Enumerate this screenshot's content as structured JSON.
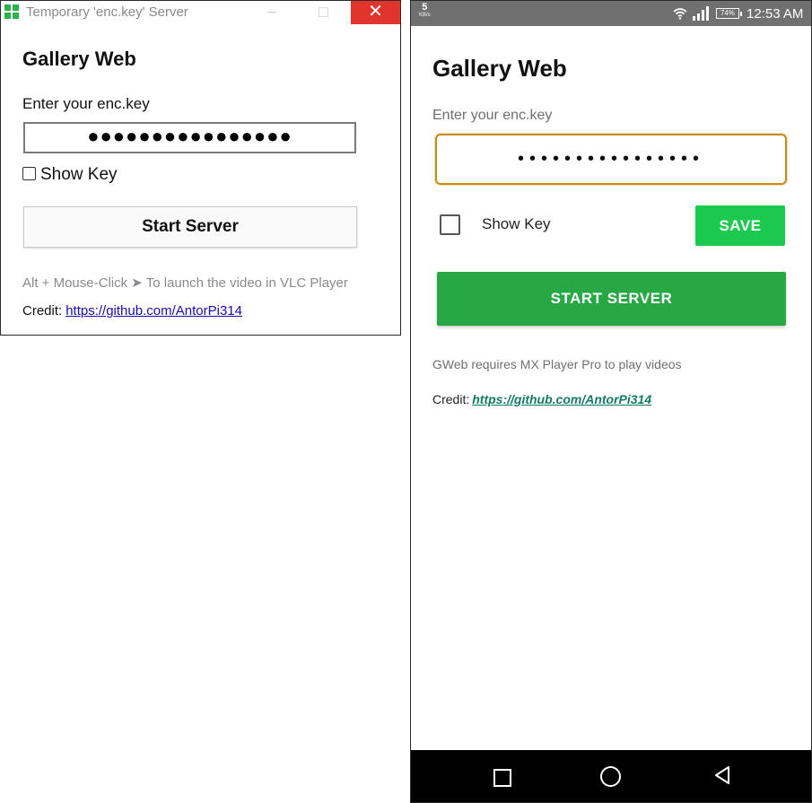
{
  "desktop": {
    "window_title": "Temporary 'enc.key' Server",
    "close_glyph": "✕",
    "heading": "Gallery Web",
    "input_label": "Enter your enc.key",
    "input_value": "●●●●●●●●●●●●●●●●",
    "show_key_label": "Show Key",
    "start_button": "Start Server",
    "hint": "Alt + Mouse-Click ➤ To launch the video in VLC Player",
    "credit_label": "Credit:",
    "credit_link": "https://github.com/AntorPi314",
    "colors": {
      "close_button": "#e0342c",
      "link": "#1a0dab",
      "icon": "#2bb24c"
    }
  },
  "phone": {
    "status": {
      "net_speed": "5",
      "net_speed_unit": "KB/s",
      "battery": "74%",
      "time": "12:53 AM"
    },
    "heading": "Gallery Web",
    "input_label": "Enter your enc.key",
    "input_value": "••••••••••••••••",
    "show_key_label": "Show Key",
    "save_button": "SAVE",
    "start_button": "START SERVER",
    "hint": "GWeb requires MX Player Pro to play videos",
    "credit_label": "Credit:",
    "credit_link": "https://github.com/AntorPi314",
    "colors": {
      "save": "#1cc94f",
      "start": "#28a745",
      "input_border": "#c98a17",
      "link": "#137a63"
    },
    "nav_icons": [
      "recents-square-icon",
      "home-circle-icon",
      "back-triangle-icon"
    ]
  }
}
